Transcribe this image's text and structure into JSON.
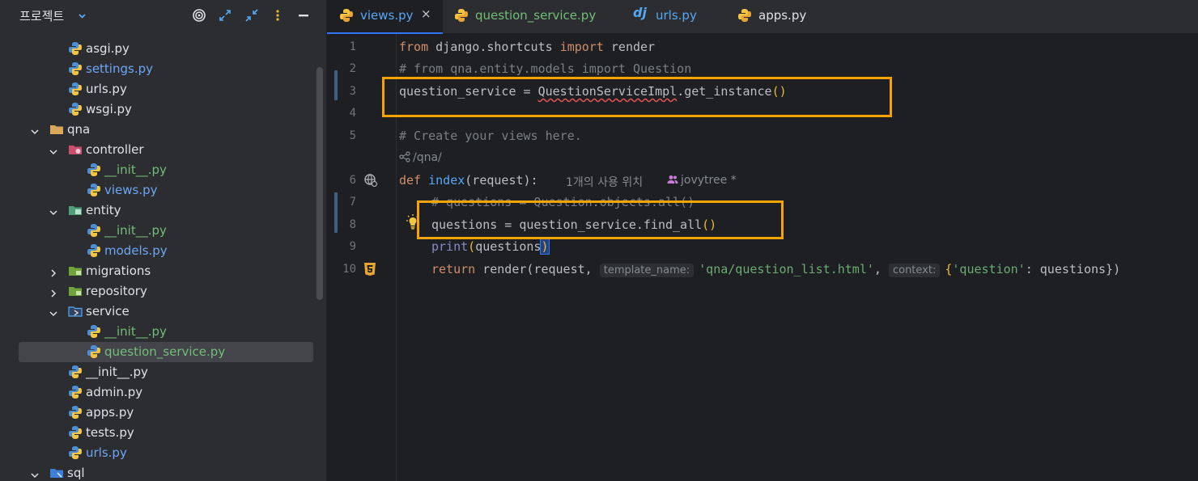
{
  "project": {
    "title": "프로젝트",
    "tree": [
      {
        "label": "asgi.py",
        "color": "def",
        "icon": "python-file-icon",
        "name": "tree-item-asgi"
      },
      {
        "label": "settings.py",
        "color": "blue",
        "icon": "python-file-icon",
        "name": "tree-item-settings"
      },
      {
        "label": "urls.py",
        "color": "def",
        "icon": "python-file-icon",
        "name": "tree-item-urls"
      },
      {
        "label": "wsgi.py",
        "color": "def",
        "icon": "python-file-icon",
        "name": "tree-item-wsgi"
      },
      {
        "label": "qna",
        "color": "def",
        "icon": "folder-icon",
        "name": "tree-item-qna"
      },
      {
        "label": "controller",
        "color": "def",
        "icon": "controller-package-icon",
        "name": "tree-item-controller"
      },
      {
        "label": "__init__.py",
        "color": "green",
        "icon": "python-file-icon",
        "name": "tree-item-controller-init"
      },
      {
        "label": "views.py",
        "color": "blue",
        "icon": "python-file-icon",
        "name": "tree-item-views"
      },
      {
        "label": "entity",
        "color": "def",
        "icon": "entity-package-icon",
        "name": "tree-item-entity"
      },
      {
        "label": "__init__.py",
        "color": "green",
        "icon": "python-file-icon",
        "name": "tree-item-entity-init"
      },
      {
        "label": "models.py",
        "color": "blue",
        "icon": "python-file-icon",
        "name": "tree-item-models"
      },
      {
        "label": "migrations",
        "color": "def",
        "icon": "package-icon",
        "name": "tree-item-migrations"
      },
      {
        "label": "repository",
        "color": "def",
        "icon": "package-icon",
        "name": "tree-item-repository"
      },
      {
        "label": "service",
        "color": "def",
        "icon": "service-package-icon",
        "name": "tree-item-service"
      },
      {
        "label": "__init__.py",
        "color": "green",
        "icon": "python-file-icon",
        "name": "tree-item-service-init"
      },
      {
        "label": "question_service.py",
        "color": "green",
        "icon": "python-file-icon",
        "name": "tree-item-question-service"
      },
      {
        "label": "__init__.py",
        "color": "def",
        "icon": "python-file-icon",
        "name": "tree-item-qna-init"
      },
      {
        "label": "admin.py",
        "color": "def",
        "icon": "python-file-icon",
        "name": "tree-item-admin"
      },
      {
        "label": "apps.py",
        "color": "def",
        "icon": "python-file-icon",
        "name": "tree-item-apps"
      },
      {
        "label": "tests.py",
        "color": "def",
        "icon": "python-file-icon",
        "name": "tree-item-tests"
      },
      {
        "label": "urls.py",
        "color": "blue",
        "icon": "python-file-icon",
        "name": "tree-item-qna-urls"
      },
      {
        "label": "sql",
        "color": "def",
        "icon": "sql-folder-icon",
        "name": "tree-item-sql"
      }
    ]
  },
  "tabs": [
    {
      "label": "views.py",
      "icon": "python-file-icon"
    },
    {
      "label": "question_service.py",
      "icon": "python-file-icon"
    },
    {
      "label": "urls.py",
      "icon": "django-icon"
    },
    {
      "label": "apps.py",
      "icon": "python-file-icon"
    }
  ],
  "tab_close": "×",
  "editor": {
    "line_numbers": [
      "1",
      "2",
      "3",
      "4",
      "5",
      "6",
      "7",
      "8",
      "9",
      "10"
    ],
    "lines": {
      "l1": {
        "kw1": "from",
        "mod": " django.shortcuts ",
        "kw2": "import",
        "rest": " render"
      },
      "l2": {
        "comment": "# from qna.entity.models import Question"
      },
      "l3": {
        "a": "question_service = ",
        "cls": "QuestionServiceImpl",
        "b": ".get_instance",
        "p": "()"
      },
      "l5": {
        "comment": "# Create your views here."
      },
      "route": "/qna/",
      "l6": {
        "kw": "def",
        "fn": "index",
        "a": "(request):"
      },
      "l6_hint": {
        "usages": "1개의 사용 위치",
        "author": "jovytree *"
      },
      "l7": {
        "comment": "# questions = Question.objects.all()"
      },
      "l8": {
        "a": "questions = question_service.find_all",
        "p": "()"
      },
      "l9": {
        "bi": "print",
        "a": "(",
        "b": "questions",
        ",c": ")"
      },
      "l10": {
        "kw": "return",
        "a": " render(request, ",
        "hint1": "template_name:",
        "str1": "'qna/question_list.html'",
        "comma": ", ",
        "hint2": "context:",
        "b": "{",
        "str2": "'question'",
        "c": ": questions})"
      }
    }
  }
}
